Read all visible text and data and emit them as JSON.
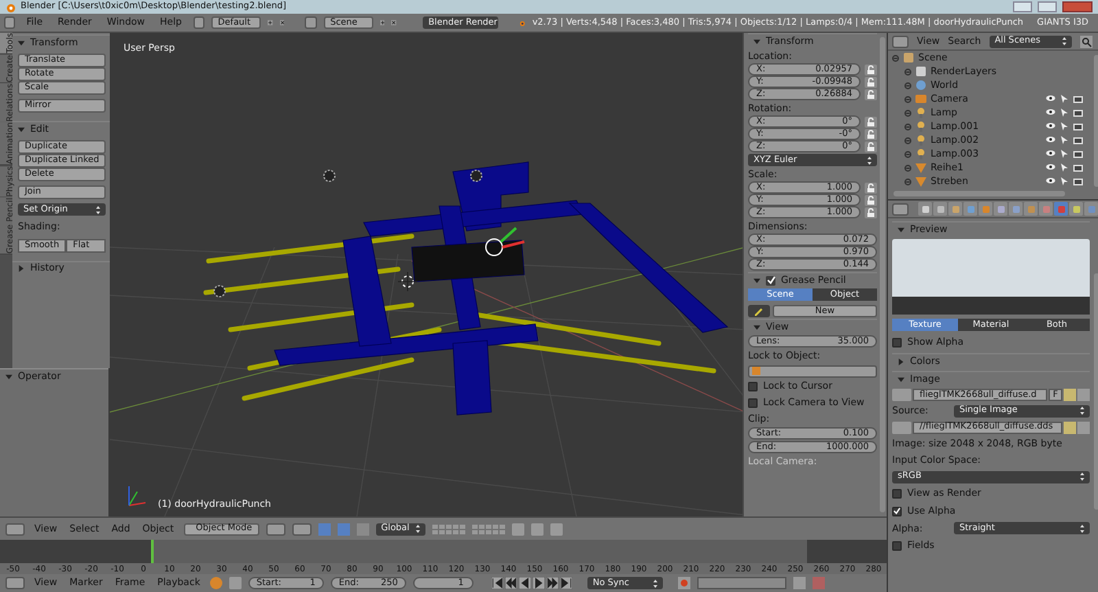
{
  "window": {
    "title": "Blender  [C:\\Users\\t0xic0m\\Desktop\\Blender\\testing2.blend]"
  },
  "info_header": {
    "menus": [
      "File",
      "Render",
      "Window",
      "Help"
    ],
    "layout": "Default",
    "scene": "Scene",
    "engine": "Blender Render",
    "stats": "v2.73 | Verts:4,548 | Faces:3,480 | Tris:5,974 | Objects:1/12 | Lamps:0/4 | Mem:111.48M | doorHydraulicPunch",
    "addon": "GIANTS I3D"
  },
  "tool_shelf": {
    "tabs": [
      {
        "label": "Tools",
        "selected": true
      },
      {
        "label": "Create",
        "selected": false
      },
      {
        "label": "Relations",
        "selected": false
      },
      {
        "label": "Animation",
        "selected": false
      },
      {
        "label": "Physics",
        "selected": false
      },
      {
        "label": "Grease Pencil",
        "selected": false
      }
    ],
    "panels": [
      {
        "title": "Transform",
        "expanded": true,
        "items": [
          {
            "kind": "stack",
            "buttons": [
              "Translate",
              "Rotate",
              "Scale"
            ]
          },
          {
            "kind": "stack",
            "buttons": [
              "Mirror"
            ]
          }
        ]
      },
      {
        "title": "Edit",
        "expanded": true,
        "items": [
          {
            "kind": "stack",
            "buttons": [
              "Duplicate",
              "Duplicate Linked",
              "Delete"
            ]
          },
          {
            "kind": "stack",
            "buttons": [
              "Join"
            ]
          },
          {
            "kind": "dropdown",
            "label": "Set Origin"
          },
          {
            "kind": "label",
            "label": "Shading:"
          },
          {
            "kind": "row",
            "buttons": [
              "Smooth",
              "Flat"
            ]
          }
        ]
      },
      {
        "title": "History",
        "expanded": false
      }
    ],
    "operator": {
      "title": "Operator",
      "expanded": true
    }
  },
  "viewport": {
    "view_name": "User Persp",
    "object_label": "(1) doorHydraulicPunch"
  },
  "n_panel": {
    "transform": {
      "title": "Transform",
      "expanded": true,
      "items": [
        {
          "kind": "vector",
          "label": "Location:",
          "lockable": true,
          "rows": [
            {
              "axis": "X:",
              "value": "0.02957"
            },
            {
              "axis": "Y:",
              "value": "-0.09948"
            },
            {
              "axis": "Z:",
              "value": "0.26884"
            }
          ]
        },
        {
          "kind": "vector",
          "label": "Rotation:",
          "lockable": true,
          "rows": [
            {
              "axis": "X:",
              "value": "0°"
            },
            {
              "axis": "Y:",
              "value": "-0°"
            },
            {
              "axis": "Z:",
              "value": "0°"
            }
          ]
        },
        {
          "kind": "dropdown",
          "value": "XYZ Euler"
        },
        {
          "kind": "vector",
          "label": "Scale:",
          "lockable": true,
          "rows": [
            {
              "axis": "X:",
              "value": "1.000"
            },
            {
              "axis": "Y:",
              "value": "1.000"
            },
            {
              "axis": "Z:",
              "value": "1.000"
            }
          ]
        },
        {
          "kind": "vector",
          "label": "Dimensions:",
          "lockable": false,
          "rows": [
            {
              "axis": "X:",
              "value": "0.072"
            },
            {
              "axis": "Y:",
              "value": "0.970"
            },
            {
              "axis": "Z:",
              "value": "0.144"
            }
          ]
        }
      ]
    },
    "grease_pencil": {
      "title": "Grease Pencil",
      "expanded": true,
      "checked": true,
      "tabs": [
        {
          "label": "Scene",
          "selected": true
        },
        {
          "label": "Object",
          "selected": false
        }
      ],
      "new_button": "New"
    },
    "view": {
      "title": "View",
      "expanded": true,
      "lens": {
        "label": "Lens:",
        "value": "35.000"
      },
      "lock_label": "Lock to Object:",
      "checks": [
        {
          "label": "Lock to Cursor",
          "checked": false
        },
        {
          "label": "Lock Camera to View",
          "checked": false
        }
      ],
      "clip_label": "Clip:",
      "clip": [
        {
          "label": "Start:",
          "value": "0.100"
        },
        {
          "label": "End:",
          "value": "1000.000"
        }
      ],
      "local_camera": "Local Camera:"
    }
  },
  "outliner": {
    "menus": [
      "View",
      "Search"
    ],
    "filter": "All Scenes",
    "tree": [
      {
        "label": "Scene",
        "kind": "scene",
        "children": [
          {
            "label": "RenderLayers",
            "kind": "renderlayers"
          },
          {
            "label": "World",
            "kind": "world"
          },
          {
            "label": "Camera",
            "kind": "camera"
          },
          {
            "label": "Lamp",
            "kind": "lamp"
          },
          {
            "label": "Lamp.001",
            "kind": "lamp"
          },
          {
            "label": "Lamp.002",
            "kind": "lamp"
          },
          {
            "label": "Lamp.003",
            "kind": "lamp"
          },
          {
            "label": "Reihe1",
            "kind": "mesh"
          },
          {
            "label": "Streben",
            "kind": "mesh"
          }
        ]
      }
    ]
  },
  "properties": {
    "context_tabs": [
      {
        "kind": "render",
        "selected": false
      },
      {
        "kind": "layers",
        "selected": false
      },
      {
        "kind": "scene",
        "selected": false
      },
      {
        "kind": "world",
        "selected": false
      },
      {
        "kind": "object",
        "selected": false
      },
      {
        "kind": "constraints",
        "selected": false
      },
      {
        "kind": "modifiers",
        "selected": false
      },
      {
        "kind": "data",
        "selected": false
      },
      {
        "kind": "material",
        "selected": false
      },
      {
        "kind": "texture",
        "selected": true
      },
      {
        "kind": "particles",
        "selected": false
      },
      {
        "kind": "physics",
        "selected": false
      }
    ],
    "preview": {
      "title": "Preview",
      "expanded": true,
      "tabs": [
        {
          "label": "Texture",
          "selected": true
        },
        {
          "label": "Material",
          "selected": false
        },
        {
          "label": "Both",
          "selected": false
        }
      ],
      "show_alpha": {
        "label": "Show Alpha",
        "checked": false
      }
    },
    "colors": {
      "title": "Colors",
      "expanded": false
    },
    "image": {
      "title": "Image",
      "expanded": true,
      "name": "flieglTMK2668ull_diffuse.d",
      "fake_user": "F",
      "source_label": "Source:",
      "source": "Single Image",
      "filepath": "//flieglTMK2668ull_diffuse.dds",
      "info": "Image: size 2048 x 2048, RGB byte",
      "color_space_label": "Input Color Space:",
      "color_space": "sRGB",
      "checks": [
        {
          "label": "View as Render",
          "checked": false
        },
        {
          "label": "Use Alpha",
          "checked": true
        }
      ],
      "alpha_label": "Alpha:",
      "alpha": "Straight",
      "fields": {
        "label": "Fields",
        "checked": false
      }
    }
  },
  "view3d_header": {
    "menus": [
      "View",
      "Select",
      "Add",
      "Object"
    ],
    "mode": "Object Mode",
    "orientation": "Global"
  },
  "timeline": {
    "ruler": [
      "-50",
      "-40",
      "-30",
      "-20",
      "-10",
      "0",
      "10",
      "20",
      "30",
      "40",
      "50",
      "60",
      "70",
      "80",
      "90",
      "100",
      "110",
      "120",
      "130",
      "140",
      "150",
      "160",
      "170",
      "180",
      "190",
      "200",
      "210",
      "220",
      "230",
      "240",
      "250",
      "260",
      "270",
      "280"
    ],
    "menus": [
      "View",
      "Marker",
      "Frame",
      "Playback"
    ],
    "start": {
      "label": "Start:",
      "value": "1"
    },
    "end": {
      "label": "End:",
      "value": "250"
    },
    "current": "1",
    "sync": "No Sync"
  }
}
